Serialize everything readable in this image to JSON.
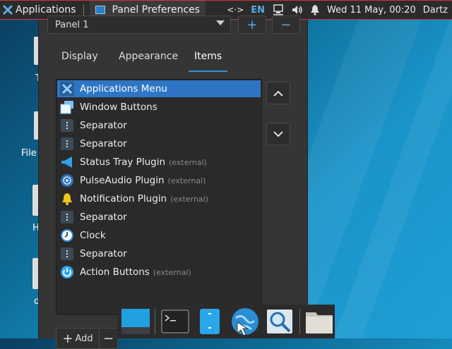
{
  "top_panel": {
    "applications_label": "Applications",
    "window_title": "Panel Preferences",
    "lang": "EN",
    "clock": "Wed 11 May, 00:20",
    "user": "Dartz",
    "icons": [
      "xfce-logo-icon",
      "window-icon",
      "network-arrows-icon",
      "network-icon",
      "volume-icon",
      "notification-bell-icon"
    ]
  },
  "desktop": {
    "labels": [
      "T",
      "File",
      "H",
      "d"
    ]
  },
  "dialog": {
    "panel_select": "Panel 1",
    "add_panel": "+",
    "remove_panel": "−",
    "tabs": [
      "Display",
      "Appearance",
      "Items"
    ],
    "active_tab": "Items",
    "items": [
      {
        "label": "Applications Menu",
        "ext": "",
        "icon": "xfce-menu-icon",
        "selected": true
      },
      {
        "label": "Window Buttons",
        "ext": "",
        "icon": "windows-icon",
        "selected": false
      },
      {
        "label": "Separator",
        "ext": "",
        "icon": "separator-icon",
        "selected": false
      },
      {
        "label": "Separator",
        "ext": "",
        "icon": "separator-icon",
        "selected": false
      },
      {
        "label": "Status Tray Plugin",
        "ext": "(external)",
        "icon": "megaphone-icon",
        "selected": false
      },
      {
        "label": "PulseAudio Plugin",
        "ext": "(external)",
        "icon": "audio-icon",
        "selected": false
      },
      {
        "label": "Notification Plugin",
        "ext": "(external)",
        "icon": "bell-icon",
        "selected": false
      },
      {
        "label": "Separator",
        "ext": "",
        "icon": "separator-icon",
        "selected": false
      },
      {
        "label": "Clock",
        "ext": "",
        "icon": "clock-icon",
        "selected": false
      },
      {
        "label": "Separator",
        "ext": "",
        "icon": "separator-icon",
        "selected": false
      },
      {
        "label": "Action Buttons",
        "ext": "(external)",
        "icon": "power-icon",
        "selected": false
      }
    ],
    "add_label": "Add",
    "remove_label": "−"
  },
  "dock": {
    "icons": [
      "show-desktop-icon",
      "terminal-icon",
      "file-manager-icon",
      "web-browser-icon",
      "app-finder-icon",
      "folder-icon"
    ]
  },
  "colors": {
    "accent": "#2e75c5",
    "panel_border": "#c63a3a"
  }
}
